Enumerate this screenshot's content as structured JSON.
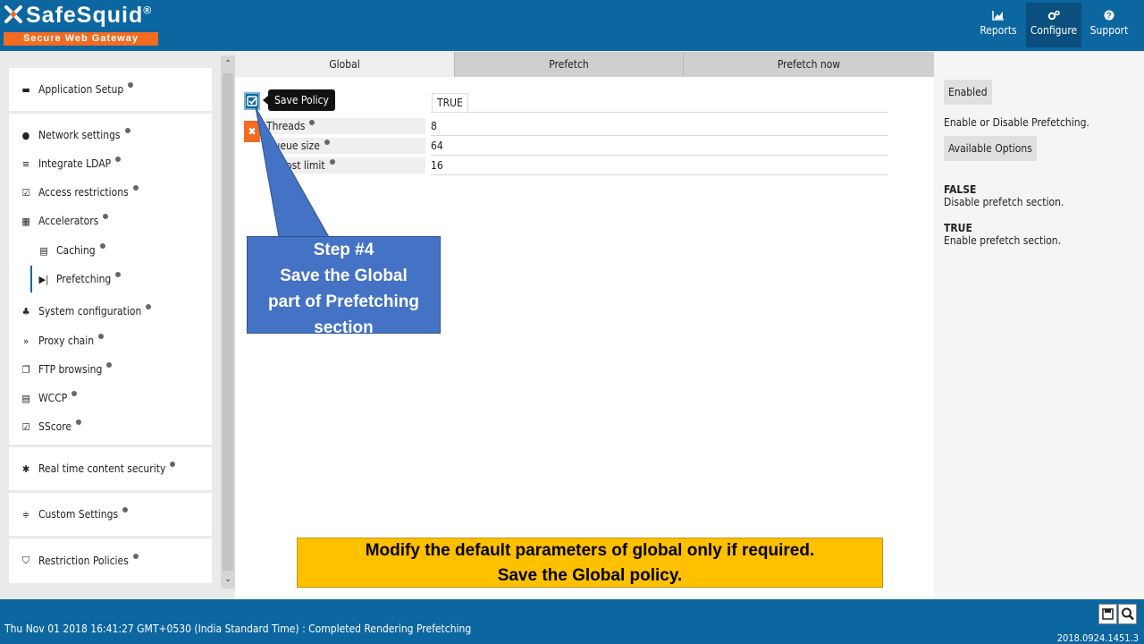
{
  "header": {
    "logo_text": "SafeSquid",
    "logo_mark": "®",
    "logo_tagline": "Secure Web Gateway",
    "nav": [
      {
        "label": "Reports",
        "icon": "chart-icon"
      },
      {
        "label": "Configure",
        "icon": "gears-icon"
      },
      {
        "label": "Support",
        "icon": "help-icon"
      }
    ]
  },
  "sidebar": {
    "application_setup": "Application Setup",
    "items": [
      {
        "label": "Network settings",
        "icon": "globe-icon"
      },
      {
        "label": "Integrate LDAP",
        "icon": "list-icon"
      },
      {
        "label": "Access restrictions",
        "icon": "checkbox-icon"
      },
      {
        "label": "Accelerators",
        "icon": "accelerator-icon"
      },
      {
        "label": "Caching",
        "icon": "server-icon"
      },
      {
        "label": "Prefetching",
        "icon": "step-forward-icon"
      },
      {
        "label": "System configuration",
        "icon": "sitemap-icon"
      },
      {
        "label": "Proxy chain",
        "icon": "fast-forward-icon"
      },
      {
        "label": "FTP browsing",
        "icon": "copy-icon"
      },
      {
        "label": "WCCP",
        "icon": "server-icon"
      },
      {
        "label": "SScore",
        "icon": "checkbox-icon"
      }
    ],
    "realtime": "Real time content security",
    "custom": "Custom Settings",
    "restriction": "Restriction Policies"
  },
  "tabs": [
    "Global",
    "Prefetch",
    "Prefetch now"
  ],
  "form": {
    "tooltip": "Save Policy",
    "enabled_value": "TRUE",
    "fields": [
      {
        "label": "Threads",
        "value": "8"
      },
      {
        "label": "Queue size",
        "value": "64"
      },
      {
        "label": "ost limit",
        "value": "16"
      }
    ]
  },
  "help_panel": {
    "enabled_btn": "Enabled",
    "description": "Enable or Disable Prefetching.",
    "options_btn": "Available Options",
    "options": [
      {
        "name": "FALSE",
        "desc": "Disable prefetch section."
      },
      {
        "name": "TRUE",
        "desc": "Enable prefetch section."
      }
    ]
  },
  "callout": {
    "lines": [
      "Step #4",
      "Save the Global",
      "part of Prefetching",
      "section"
    ]
  },
  "note": {
    "line1": "Modify the default parameters of global only if required.",
    "line2": "Save the Global policy."
  },
  "footer": {
    "status": "Thu Nov 01 2018 16:41:27 GMT+0530 (India Standard Time) : Completed Rendering Prefetching",
    "version": "2018.0924.1451.3"
  },
  "colors": {
    "brand_blue": "#0c66a0",
    "brand_orange": "#f26b21",
    "callout_blue": "#4472c4",
    "note_yellow": "#ffc000"
  }
}
